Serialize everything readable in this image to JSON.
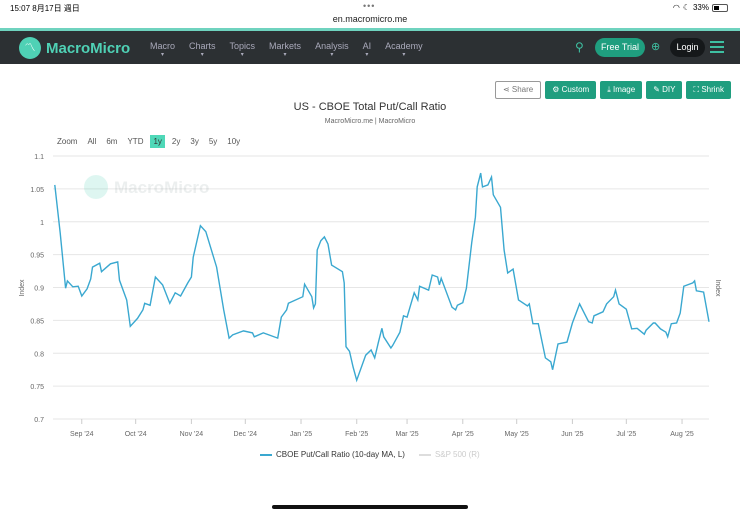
{
  "status": {
    "time": "15:07  8月17日 週日",
    "url": "en.macromicro.me",
    "battery": "33%"
  },
  "nav": {
    "brand": "MacroMicro",
    "items": [
      "Macro",
      "Charts",
      "Topics",
      "Markets",
      "Analysis",
      "AI",
      "Academy"
    ],
    "free_trial": "Free Trial",
    "login": "Login"
  },
  "toolbar": {
    "share": "Share",
    "custom": "Custom",
    "image": "Image",
    "diy": "DIY",
    "shrink": "Shrink"
  },
  "zoom": {
    "label": "Zoom",
    "options": [
      "All",
      "6m",
      "YTD",
      "1y",
      "2y",
      "3y",
      "5y",
      "10y"
    ],
    "selected": "1y"
  },
  "colors": {
    "accent": "#1f9e7f",
    "line": "#3aa8d0"
  },
  "chart_data": {
    "type": "line",
    "title": "US - CBOE Total Put/Call Ratio",
    "subtitle": "MacroMicro.me | MacroMicro",
    "watermark": "MacroMicro",
    "ylabel_left": "Index",
    "ylabel_right": "Index",
    "ylim": [
      0.7,
      1.1
    ],
    "yticks": [
      "1.1",
      "1.05",
      "1",
      "0.95",
      "0.9",
      "0.85",
      "0.8",
      "0.75",
      "0.7"
    ],
    "x_start_date": "2024-08-16",
    "x_unit": "days since start",
    "xlim": [
      0,
      365
    ],
    "xticks": [
      {
        "label": "Sep '24",
        "day": 16
      },
      {
        "label": "Oct '24",
        "day": 46
      },
      {
        "label": "Nov '24",
        "day": 77
      },
      {
        "label": "Dec '24",
        "day": 107
      },
      {
        "label": "Jan '25",
        "day": 138
      },
      {
        "label": "Feb '25",
        "day": 169
      },
      {
        "label": "Mar '25",
        "day": 197
      },
      {
        "label": "Apr '25",
        "day": 228
      },
      {
        "label": "May '25",
        "day": 258
      },
      {
        "label": "Jun '25",
        "day": 289
      },
      {
        "label": "Jul '25",
        "day": 319
      },
      {
        "label": "Aug '25",
        "day": 350
      }
    ],
    "series": [
      {
        "name": "CBOE Put/Call Ratio (10-day MA, L)",
        "points": [
          [
            1,
            1.056
          ],
          [
            4,
            0.983
          ],
          [
            7,
            0.899
          ],
          [
            8,
            0.91
          ],
          [
            11,
            0.901
          ],
          [
            14,
            0.902
          ],
          [
            16,
            0.887
          ],
          [
            19,
            0.898
          ],
          [
            21,
            0.913
          ],
          [
            22,
            0.931
          ],
          [
            26,
            0.937
          ],
          [
            27,
            0.924
          ],
          [
            32,
            0.936
          ],
          [
            36,
            0.939
          ],
          [
            37,
            0.911
          ],
          [
            41,
            0.881
          ],
          [
            43,
            0.841
          ],
          [
            47,
            0.853
          ],
          [
            50,
            0.866
          ],
          [
            51,
            0.876
          ],
          [
            54,
            0.873
          ],
          [
            57,
            0.916
          ],
          [
            61,
            0.904
          ],
          [
            65,
            0.876
          ],
          [
            68,
            0.892
          ],
          [
            71,
            0.887
          ],
          [
            75,
            0.907
          ],
          [
            77,
            0.916
          ],
          [
            78,
            0.946
          ],
          [
            82,
            0.994
          ],
          [
            85,
            0.985
          ],
          [
            91,
            0.931
          ],
          [
            95,
            0.866
          ],
          [
            98,
            0.823
          ],
          [
            100,
            0.828
          ],
          [
            106,
            0.834
          ],
          [
            111,
            0.831
          ],
          [
            112,
            0.825
          ],
          [
            117,
            0.831
          ],
          [
            125,
            0.823
          ],
          [
            127,
            0.855
          ],
          [
            130,
            0.866
          ],
          [
            131,
            0.876
          ],
          [
            139,
            0.886
          ],
          [
            140,
            0.905
          ],
          [
            144,
            0.886
          ],
          [
            145,
            0.869
          ],
          [
            146,
            0.875
          ],
          [
            147,
            0.957
          ],
          [
            149,
            0.971
          ],
          [
            151,
            0.977
          ],
          [
            153,
            0.966
          ],
          [
            155,
            0.934
          ],
          [
            161,
            0.924
          ],
          [
            162,
            0.907
          ],
          [
            163,
            0.81
          ],
          [
            165,
            0.803
          ],
          [
            167,
            0.779
          ],
          [
            169,
            0.759
          ],
          [
            174,
            0.797
          ],
          [
            177,
            0.805
          ],
          [
            179,
            0.793
          ],
          [
            181,
            0.816
          ],
          [
            183,
            0.838
          ],
          [
            184,
            0.825
          ],
          [
            188,
            0.808
          ],
          [
            189,
            0.812
          ],
          [
            193,
            0.832
          ],
          [
            195,
            0.857
          ],
          [
            197,
            0.855
          ],
          [
            201,
            0.892
          ],
          [
            203,
            0.881
          ],
          [
            204,
            0.902
          ],
          [
            209,
            0.896
          ],
          [
            211,
            0.919
          ],
          [
            214,
            0.916
          ],
          [
            215,
            0.904
          ],
          [
            216,
            0.914
          ],
          [
            222,
            0.87
          ],
          [
            224,
            0.866
          ],
          [
            225,
            0.873
          ],
          [
            228,
            0.877
          ],
          [
            230,
            0.899
          ],
          [
            233,
            0.969
          ],
          [
            235,
            1.007
          ],
          [
            236,
            1.053
          ],
          [
            238,
            1.074
          ],
          [
            239,
            1.053
          ],
          [
            242,
            1.056
          ],
          [
            244,
            1.068
          ],
          [
            245,
            1.041
          ],
          [
            249,
            1.022
          ],
          [
            251,
            0.957
          ],
          [
            253,
            0.922
          ],
          [
            256,
            0.928
          ],
          [
            259,
            0.881
          ],
          [
            264,
            0.872
          ],
          [
            265,
            0.875
          ],
          [
            267,
            0.845
          ],
          [
            270,
            0.845
          ],
          [
            274,
            0.793
          ],
          [
            277,
            0.787
          ],
          [
            278,
            0.775
          ],
          [
            281,
            0.814
          ],
          [
            286,
            0.817
          ],
          [
            289,
            0.846
          ],
          [
            293,
            0.875
          ],
          [
            298,
            0.848
          ],
          [
            300,
            0.846
          ],
          [
            301,
            0.857
          ],
          [
            306,
            0.863
          ],
          [
            308,
            0.875
          ],
          [
            312,
            0.886
          ],
          [
            313,
            0.896
          ],
          [
            315,
            0.875
          ],
          [
            319,
            0.867
          ],
          [
            322,
            0.837
          ],
          [
            325,
            0.838
          ],
          [
            329,
            0.829
          ],
          [
            330,
            0.835
          ],
          [
            334,
            0.846
          ],
          [
            335,
            0.846
          ],
          [
            338,
            0.837
          ],
          [
            341,
            0.832
          ],
          [
            342,
            0.825
          ],
          [
            344,
            0.845
          ],
          [
            347,
            0.846
          ],
          [
            349,
            0.861
          ],
          [
            351,
            0.902
          ],
          [
            356,
            0.907
          ],
          [
            357,
            0.91
          ],
          [
            358,
            0.895
          ],
          [
            362,
            0.893
          ],
          [
            365,
            0.848
          ]
        ]
      },
      {
        "name": "S&P 500 (R)",
        "hidden": true,
        "points": []
      }
    ],
    "legend_position": "bottom",
    "grid": true
  }
}
